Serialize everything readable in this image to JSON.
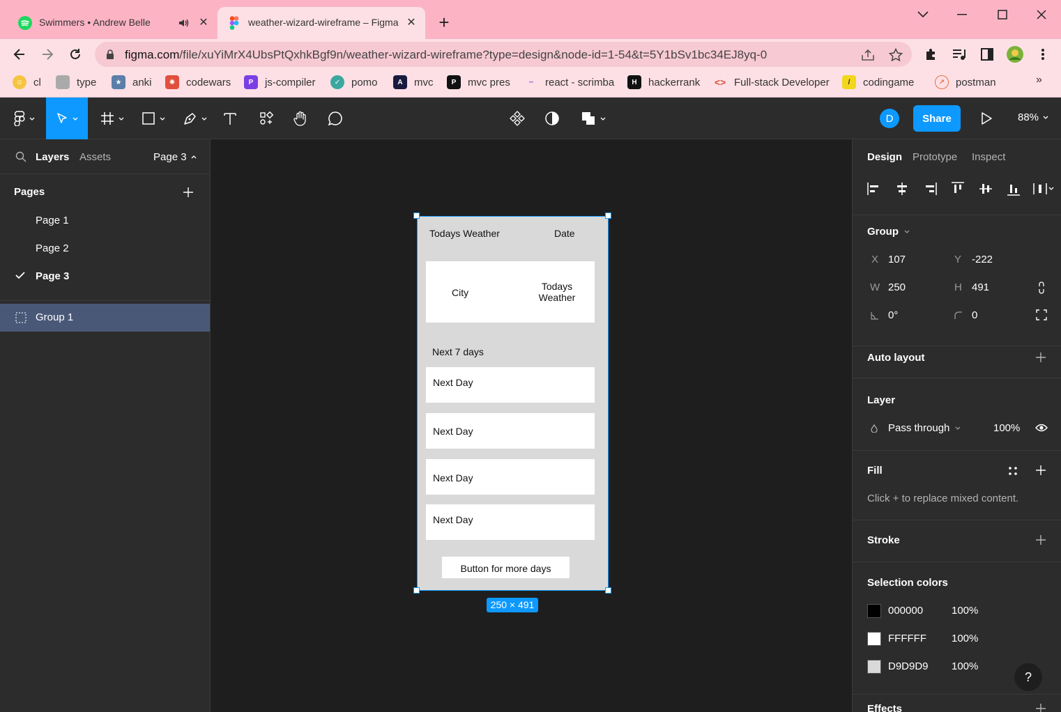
{
  "browser": {
    "tabs": [
      {
        "title": "Swimmers • Andrew Belle",
        "icon": "spotify-icon",
        "active": false
      },
      {
        "title": "weather-wizard-wireframe – Figma",
        "icon": "figma-icon",
        "active": true
      }
    ],
    "url_domain": "figma.com",
    "url_path": "/file/xuYiMrX4UbsPtQxhkBgf9n/weather-wizard-wireframe?type=design&node-id=1-54&t=5Y1bSv1bc34EJ8yq-0",
    "bookmarks": [
      {
        "label": "cl"
      },
      {
        "label": "type"
      },
      {
        "label": "anki"
      },
      {
        "label": "codewars"
      },
      {
        "label": "js-compiler"
      },
      {
        "label": "pomo"
      },
      {
        "label": "mvc"
      },
      {
        "label": "mvc pres"
      },
      {
        "label": "react - scrimba"
      },
      {
        "label": "hackerrank"
      },
      {
        "label": "Full-stack Developer"
      },
      {
        "label": "codingame"
      },
      {
        "label": "postman"
      }
    ],
    "bookmarks_more": "»"
  },
  "figma_toolbar": {
    "avatar": "D",
    "share_label": "Share",
    "zoom": "88%"
  },
  "left_panel": {
    "tab_layers": "Layers",
    "tab_assets": "Assets",
    "current_page": "Page 3",
    "pages_title": "Pages",
    "pages": [
      "Page 1",
      "Page 2",
      "Page 3"
    ],
    "selected_page_index": 2,
    "layers": [
      {
        "name": "Group 1"
      }
    ]
  },
  "canvas": {
    "frame": {
      "header_left": "Todays Weather",
      "header_right": "Date",
      "card_city": "City",
      "card_weather": "Todays Weather",
      "next_title": "Next 7 days",
      "days": [
        "Next Day",
        "Next Day",
        "Next Day",
        "Next Day"
      ],
      "button_label": "Button for more days"
    },
    "dimensions_label": "250 × 491"
  },
  "right_panel": {
    "tabs": [
      "Design",
      "Prototype",
      "Inspect"
    ],
    "active_tab": "Design",
    "group_title": "Group",
    "x_label": "X",
    "x_value": "107",
    "y_label": "Y",
    "y_value": "-222",
    "w_label": "W",
    "w_value": "250",
    "h_label": "H",
    "h_value": "491",
    "rotation": "0°",
    "corner_radius": "0",
    "auto_layout_title": "Auto layout",
    "layer_title": "Layer",
    "blend_mode": "Pass through",
    "opacity": "100%",
    "fill_title": "Fill",
    "fill_note": "Click + to replace mixed content.",
    "stroke_title": "Stroke",
    "selection_colors_title": "Selection colors",
    "selection_colors": [
      {
        "hex": "000000",
        "opacity": "100%",
        "color": "#000000"
      },
      {
        "hex": "FFFFFF",
        "opacity": "100%",
        "color": "#FFFFFF"
      },
      {
        "hex": "D9D9D9",
        "opacity": "100%",
        "color": "#D9D9D9"
      }
    ],
    "effects_title": "Effects",
    "help": "?"
  },
  "colors": {
    "accent": "#0d99ff",
    "tabbar": "#fcb4c5",
    "toolbar": "#fde0e6",
    "panel": "#2c2c2c",
    "canvas": "#1e1e1e",
    "frame_fill": "#d9d9d9",
    "selected_layer": "#4a5878"
  }
}
